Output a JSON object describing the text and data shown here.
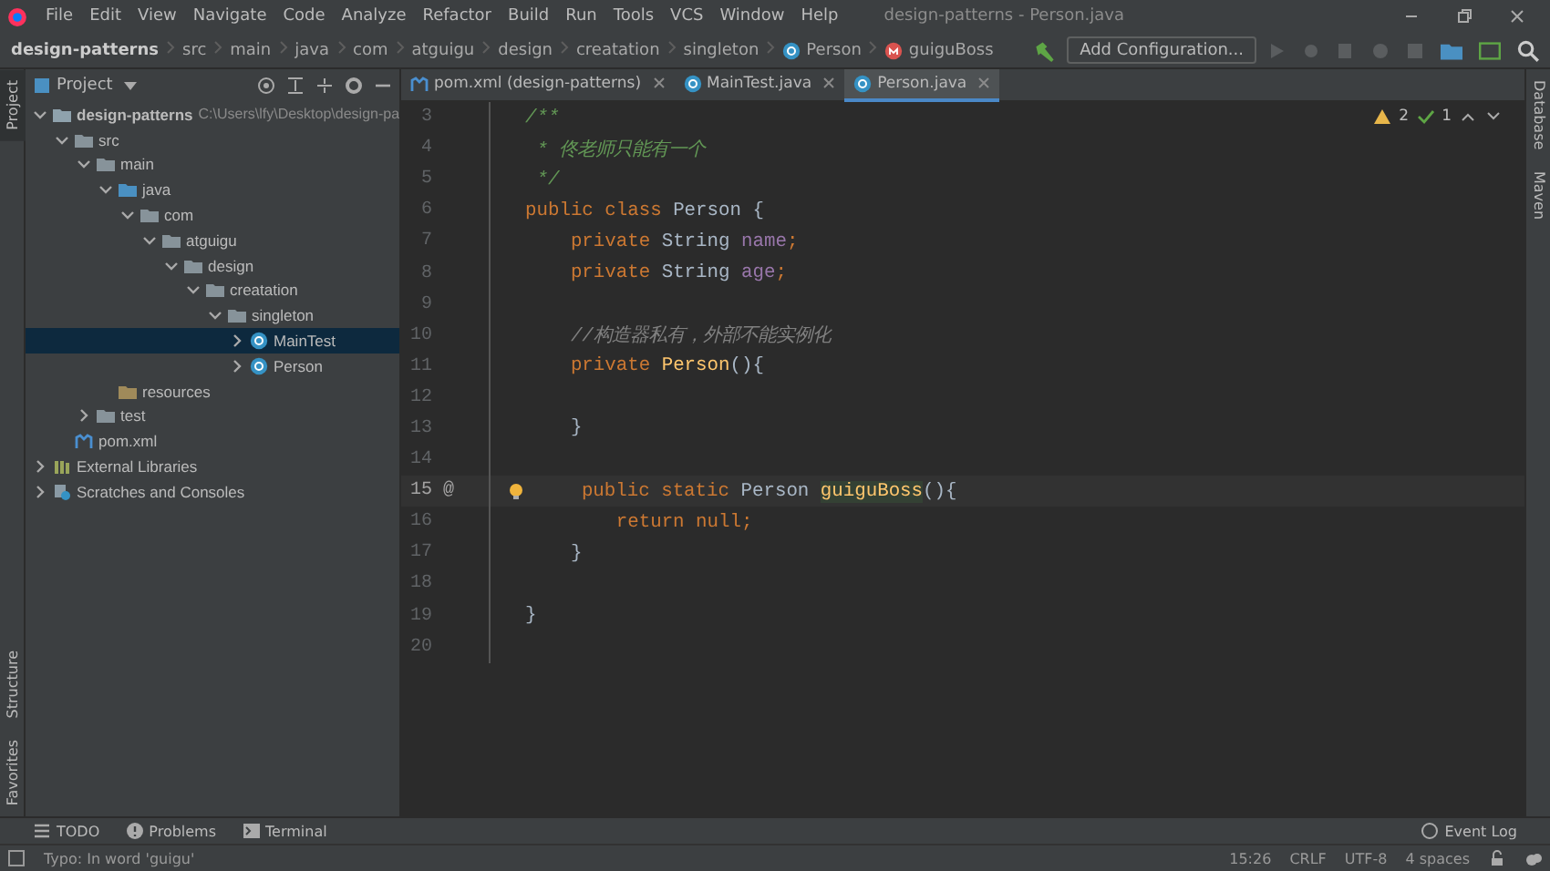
{
  "window": {
    "title": "design-patterns - Person.java"
  },
  "menu": [
    "File",
    "Edit",
    "View",
    "Navigate",
    "Code",
    "Analyze",
    "Refactor",
    "Build",
    "Run",
    "Tools",
    "VCS",
    "Window",
    "Help"
  ],
  "breadcrumbs": [
    {
      "label": "design-patterns",
      "kind": "project"
    },
    {
      "label": "src",
      "kind": "plain"
    },
    {
      "label": "main",
      "kind": "plain"
    },
    {
      "label": "java",
      "kind": "plain"
    },
    {
      "label": "com",
      "kind": "plain"
    },
    {
      "label": "atguigu",
      "kind": "plain"
    },
    {
      "label": "design",
      "kind": "plain"
    },
    {
      "label": "creatation",
      "kind": "plain"
    },
    {
      "label": "singleton",
      "kind": "plain"
    },
    {
      "label": "Person",
      "kind": "class"
    },
    {
      "label": "guiguBoss",
      "kind": "method"
    }
  ],
  "toolbar": {
    "run_config": "Add Configuration..."
  },
  "left_stripe_top": [
    {
      "label": "Project",
      "selected": true
    }
  ],
  "left_stripe_bottom": [
    {
      "label": "Structure",
      "selected": false
    },
    {
      "label": "Favorites",
      "selected": false
    }
  ],
  "right_stripe": [
    {
      "label": "Database"
    },
    {
      "label": "Maven"
    }
  ],
  "project_panel": {
    "title": "Project",
    "tree": [
      {
        "label": "design-patterns",
        "path": "C:\\Users\\lfy\\Desktop\\design-pa",
        "kind": "module",
        "expanded": true,
        "selected": false,
        "children": [
          {
            "label": "src",
            "kind": "folder",
            "expanded": true,
            "selected": false,
            "children": [
              {
                "label": "main",
                "kind": "folder",
                "expanded": true,
                "selected": false,
                "children": [
                  {
                    "label": "java",
                    "kind": "source",
                    "expanded": true,
                    "selected": false,
                    "children": [
                      {
                        "label": "com",
                        "kind": "package",
                        "expanded": true,
                        "selected": false,
                        "children": [
                          {
                            "label": "atguigu",
                            "kind": "package",
                            "expanded": true,
                            "selected": false,
                            "children": [
                              {
                                "label": "design",
                                "kind": "package",
                                "expanded": true,
                                "selected": false,
                                "children": [
                                  {
                                    "label": "creatation",
                                    "kind": "package",
                                    "expanded": true,
                                    "selected": false,
                                    "children": [
                                      {
                                        "label": "singleton",
                                        "kind": "package",
                                        "expanded": true,
                                        "selected": false,
                                        "children": [
                                          {
                                            "label": "MainTest",
                                            "kind": "class",
                                            "expanded": false,
                                            "selected": true
                                          },
                                          {
                                            "label": "Person",
                                            "kind": "class",
                                            "expanded": false,
                                            "selected": false
                                          }
                                        ]
                                      }
                                    ]
                                  }
                                ]
                              }
                            ]
                          }
                        ]
                      }
                    ]
                  },
                  {
                    "label": "resources",
                    "kind": "resources",
                    "selected": false
                  }
                ]
              },
              {
                "label": "test",
                "kind": "folder",
                "expanded": false,
                "selected": false
              }
            ]
          },
          {
            "label": "pom.xml",
            "kind": "maven",
            "selected": false
          }
        ]
      },
      {
        "label": "External Libraries",
        "kind": "library",
        "expanded": false,
        "selected": false
      },
      {
        "label": "Scratches and Consoles",
        "kind": "scratches",
        "expanded": false,
        "selected": false
      }
    ]
  },
  "editor_tabs": [
    {
      "label": "pom.xml (design-patterns)",
      "kind": "maven",
      "selected": false
    },
    {
      "label": "MainTest.java",
      "kind": "class",
      "selected": false
    },
    {
      "label": "Person.java",
      "kind": "class",
      "selected": true
    }
  ],
  "inspections": {
    "warnings": "2",
    "weak_warnings": "1"
  },
  "code_lines": [
    {
      "number": "3",
      "current": false,
      "tokens": [
        {
          "kind": "comment",
          "text": "/**"
        }
      ]
    },
    {
      "number": "4",
      "current": false,
      "tokens": [
        {
          "kind": "comment",
          "text": " * 佟老师只能有一个"
        }
      ]
    },
    {
      "number": "5",
      "current": false,
      "tokens": [
        {
          "kind": "comment",
          "text": " */"
        }
      ]
    },
    {
      "number": "6",
      "current": false,
      "tokens": [
        {
          "kind": "keyword",
          "text": "public class "
        },
        {
          "kind": "plain",
          "text": "Person {"
        }
      ]
    },
    {
      "number": "7",
      "current": false,
      "tokens": [
        {
          "kind": "keyword",
          "text": "    private "
        },
        {
          "kind": "plain",
          "text": "String "
        },
        {
          "kind": "field",
          "text": "name"
        },
        {
          "kind": "punct",
          "text": ";"
        }
      ]
    },
    {
      "number": "8",
      "current": false,
      "tokens": [
        {
          "kind": "keyword",
          "text": "    private "
        },
        {
          "kind": "plain",
          "text": "String "
        },
        {
          "kind": "field",
          "text": "age"
        },
        {
          "kind": "punct",
          "text": ";"
        }
      ]
    },
    {
      "number": "9",
      "current": false
    },
    {
      "number": "10",
      "current": false,
      "tokens": [
        {
          "kind": "linecomment",
          "text": "    //构造器私有，外部不能实例化"
        }
      ]
    },
    {
      "number": "11",
      "current": false,
      "tokens": [
        {
          "kind": "keyword",
          "text": "    private "
        },
        {
          "kind": "method",
          "text": "Person"
        },
        {
          "kind": "plain",
          "text": "(){"
        }
      ]
    },
    {
      "number": "12",
      "current": false
    },
    {
      "number": "13",
      "current": false,
      "tokens": [
        {
          "kind": "plain",
          "text": "    }"
        }
      ]
    },
    {
      "number": "14",
      "current": false
    },
    {
      "number": "15",
      "current": true,
      "override": "@",
      "bulb": true,
      "tokens": [
        {
          "kind": "keyword",
          "text": "    public static "
        },
        {
          "kind": "plain",
          "text": "Person "
        },
        {
          "kind": "highlight",
          "text": "guiguBoss"
        },
        {
          "kind": "plain",
          "text": "(){"
        }
      ]
    },
    {
      "number": "16",
      "current": false,
      "tokens": [
        {
          "kind": "keyword",
          "text": "        return null"
        },
        {
          "kind": "punct",
          "text": ";"
        }
      ]
    },
    {
      "number": "17",
      "current": false,
      "tokens": [
        {
          "kind": "plain",
          "text": "    }"
        }
      ]
    },
    {
      "number": "18",
      "current": false
    },
    {
      "number": "19",
      "current": false,
      "tokens": [
        {
          "kind": "plain",
          "text": "}"
        }
      ]
    },
    {
      "number": "20",
      "current": false
    }
  ],
  "tool_tabs": [
    {
      "label": "TODO",
      "kind": "todo"
    },
    {
      "label": "Problems",
      "kind": "problems"
    },
    {
      "label": "Terminal",
      "kind": "terminal"
    }
  ],
  "event_log": "Event Log",
  "status_bar": {
    "message": "Typo: In word 'guigu'",
    "position": "15:26",
    "line_separator": "CRLF",
    "encoding": "UTF-8",
    "indent": "4 spaces"
  }
}
